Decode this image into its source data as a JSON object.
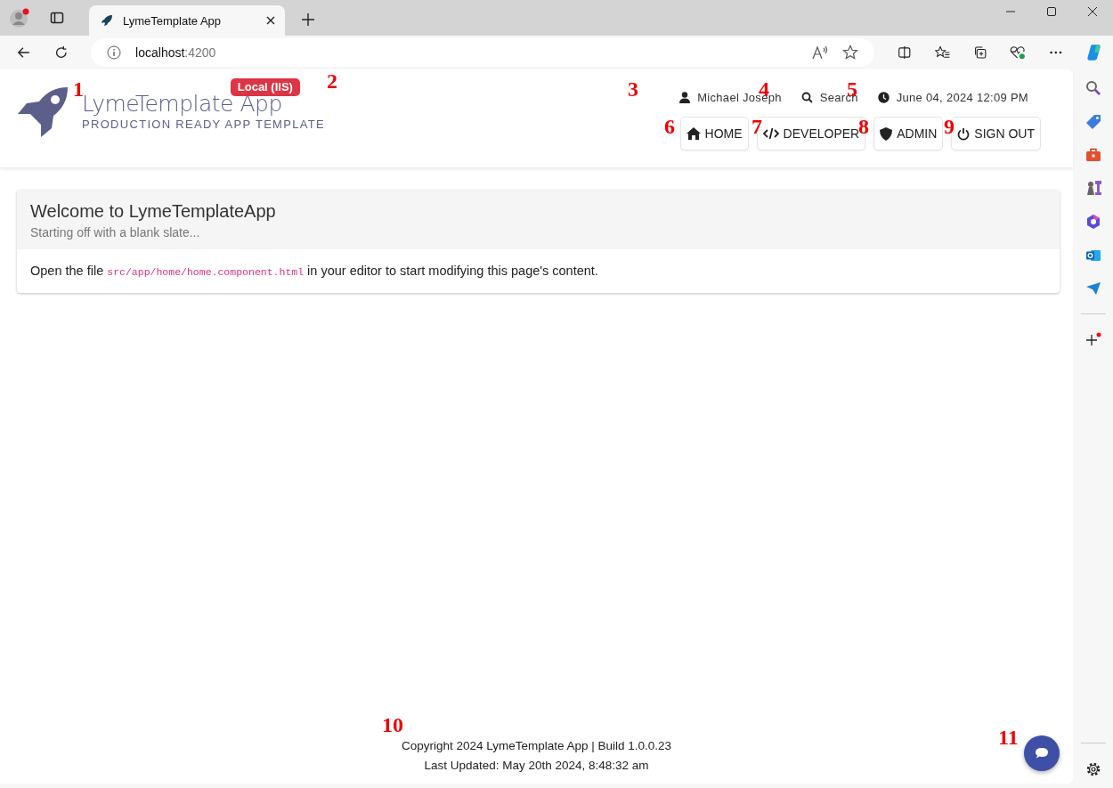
{
  "browser": {
    "tab": {
      "title": "LymeTemplate App"
    },
    "address": {
      "host": "localhost",
      "port": ":4200"
    }
  },
  "header": {
    "app_name": "LymeTemplate App",
    "tagline": "PRODUCTION READY APP TEMPLATE",
    "environment_badge": "Local (IIS)",
    "user": "Michael Joseph",
    "search": "Search",
    "datetime": "June 04, 2024 12:09 PM",
    "nav": [
      {
        "label": "HOME",
        "kind": "home"
      },
      {
        "label": "DEVELOPER",
        "kind": "code"
      },
      {
        "label": "ADMIN",
        "kind": "shield"
      },
      {
        "label": "SIGN OUT",
        "kind": "power"
      }
    ]
  },
  "card": {
    "title": "Welcome to LymeTemplateApp",
    "subtitle": "Starting off with a blank slate...",
    "body_before": "Open the file ",
    "code": "src/app/home/home.component.html",
    "body_after": " in your editor to start modifying this page's content."
  },
  "footer": {
    "copyright": "Copyright 2024 LymeTemplate App | Build 1.0.0.23",
    "last_updated": "Last Updated: May 20th 2024, 8:48:32 am"
  },
  "callouts": [
    "1",
    "2",
    "3",
    "4",
    "5",
    "6",
    "7",
    "8",
    "9",
    "10",
    "11"
  ]
}
